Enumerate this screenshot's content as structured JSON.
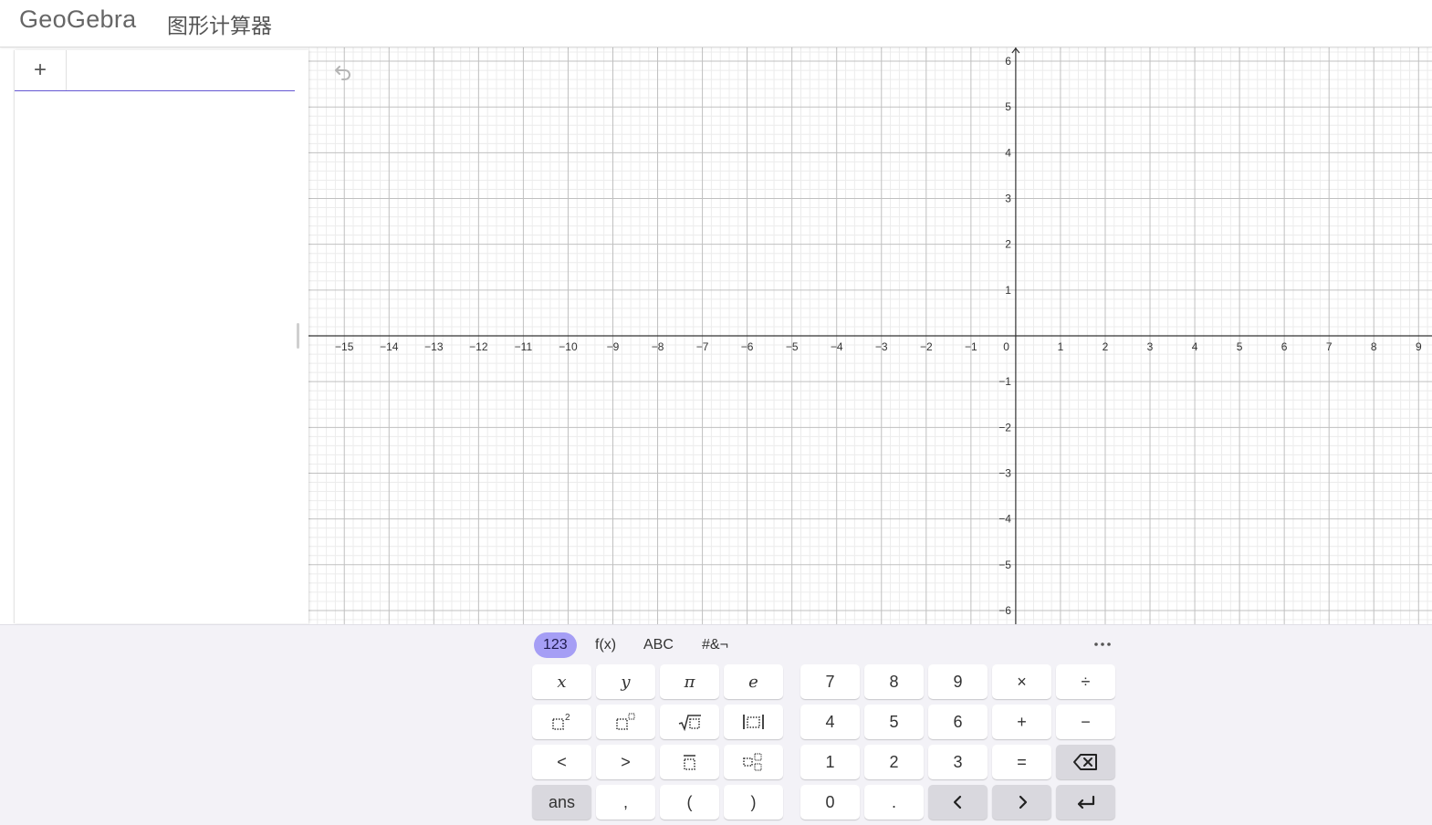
{
  "header": {
    "logo": "GeoGebra",
    "title": "图形计算器"
  },
  "algebra": {
    "add_label": "+"
  },
  "graph": {
    "x_ticks": [
      -15,
      -14,
      -13,
      -12,
      -11,
      -10,
      -9,
      -8,
      -7,
      -6,
      -5,
      -4,
      -3,
      -2,
      -1,
      1,
      2,
      3,
      4,
      5,
      6,
      7,
      8,
      9
    ],
    "y_ticks": [
      6,
      5,
      4,
      3,
      2,
      1,
      -1,
      -2,
      -3,
      -4,
      -5,
      -6
    ],
    "origin_label": "0",
    "x_range": [
      -15.8,
      9.3
    ],
    "y_range": [
      -6.3,
      6.3
    ]
  },
  "keyboard": {
    "tabs": [
      "123",
      "f(x)",
      "ABC",
      "#&¬"
    ],
    "active_tab": "123",
    "left_keys": [
      [
        "x",
        "y",
        "π",
        "e"
      ],
      [
        "square",
        "power",
        "sqrt",
        "abs"
      ],
      [
        "<",
        ">",
        "fraction",
        "subscript"
      ],
      [
        "ans",
        ",",
        "(",
        ")"
      ]
    ],
    "right_keys": [
      [
        "7",
        "8",
        "9",
        "×",
        "÷"
      ],
      [
        "4",
        "5",
        "6",
        "+",
        "−"
      ],
      [
        "1",
        "2",
        "3",
        "=",
        "backspace"
      ],
      [
        "0",
        ".",
        "left",
        "right",
        "enter"
      ]
    ]
  },
  "colors": {
    "accent": "#6557d2",
    "tab_active": "#a59ef5",
    "grid_major": "#c0c0c0",
    "grid_minor": "#ececec",
    "axis": "#333333"
  }
}
